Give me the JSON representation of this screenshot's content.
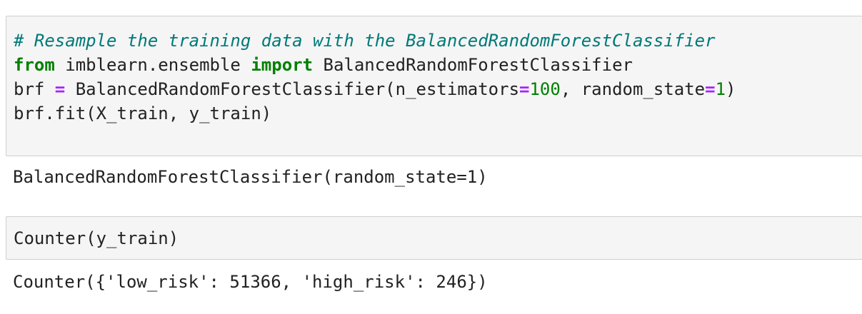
{
  "cells": [
    {
      "type": "code",
      "lines": {
        "line1": {
          "comment": "# Resample the training data with the BalancedRandomForestClassifier"
        },
        "line2": {
          "kw_from": "from",
          "module": " imblearn.ensemble ",
          "kw_import": "import",
          "name": " BalancedRandomForestClassifier"
        },
        "line3": {
          "var": "brf ",
          "eq1": "=",
          "call": " BalancedRandomForestClassifier(n_estimators",
          "eq2": "=",
          "n_est": "100",
          "sep": ", random_state",
          "eq3": "=",
          "rs": "1",
          "close": ")"
        },
        "line4": {
          "text": "brf.fit(X_train, y_train)"
        }
      },
      "output": "BalancedRandomForestClassifier(random_state=1)"
    },
    {
      "type": "code",
      "lines": {
        "line1": {
          "text": "Counter(y_train)"
        }
      },
      "output": "Counter({'low_risk': 51366, 'high_risk': 246})"
    }
  ]
}
